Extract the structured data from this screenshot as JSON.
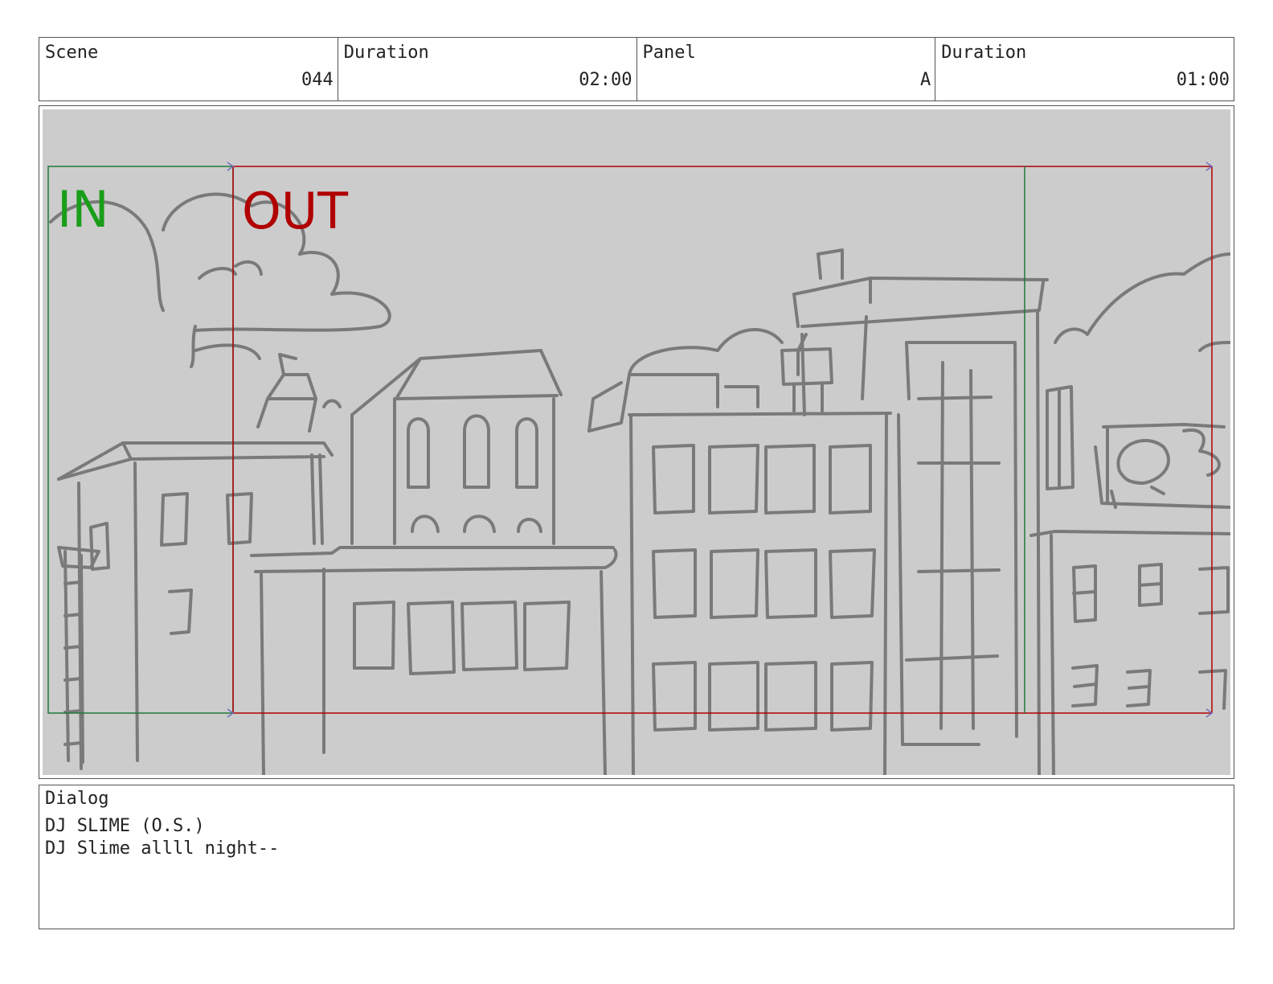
{
  "header": {
    "scene_label": "Scene",
    "scene_value": "044",
    "duration1_label": "Duration",
    "duration1_value": "02:00",
    "panel_label": "Panel",
    "panel_value": "A",
    "duration2_label": "Duration",
    "duration2_value": "01:00"
  },
  "panel": {
    "in_label": "IN",
    "out_label": "OUT",
    "in_color": "#1a9e1a",
    "out_color": "#b00000",
    "background": "#cccccc",
    "sketch_color": "#7a7a7a"
  },
  "dialog": {
    "label": "Dialog",
    "speaker": "DJ SLIME (O.S.)",
    "line": "DJ Slime allll night--"
  }
}
